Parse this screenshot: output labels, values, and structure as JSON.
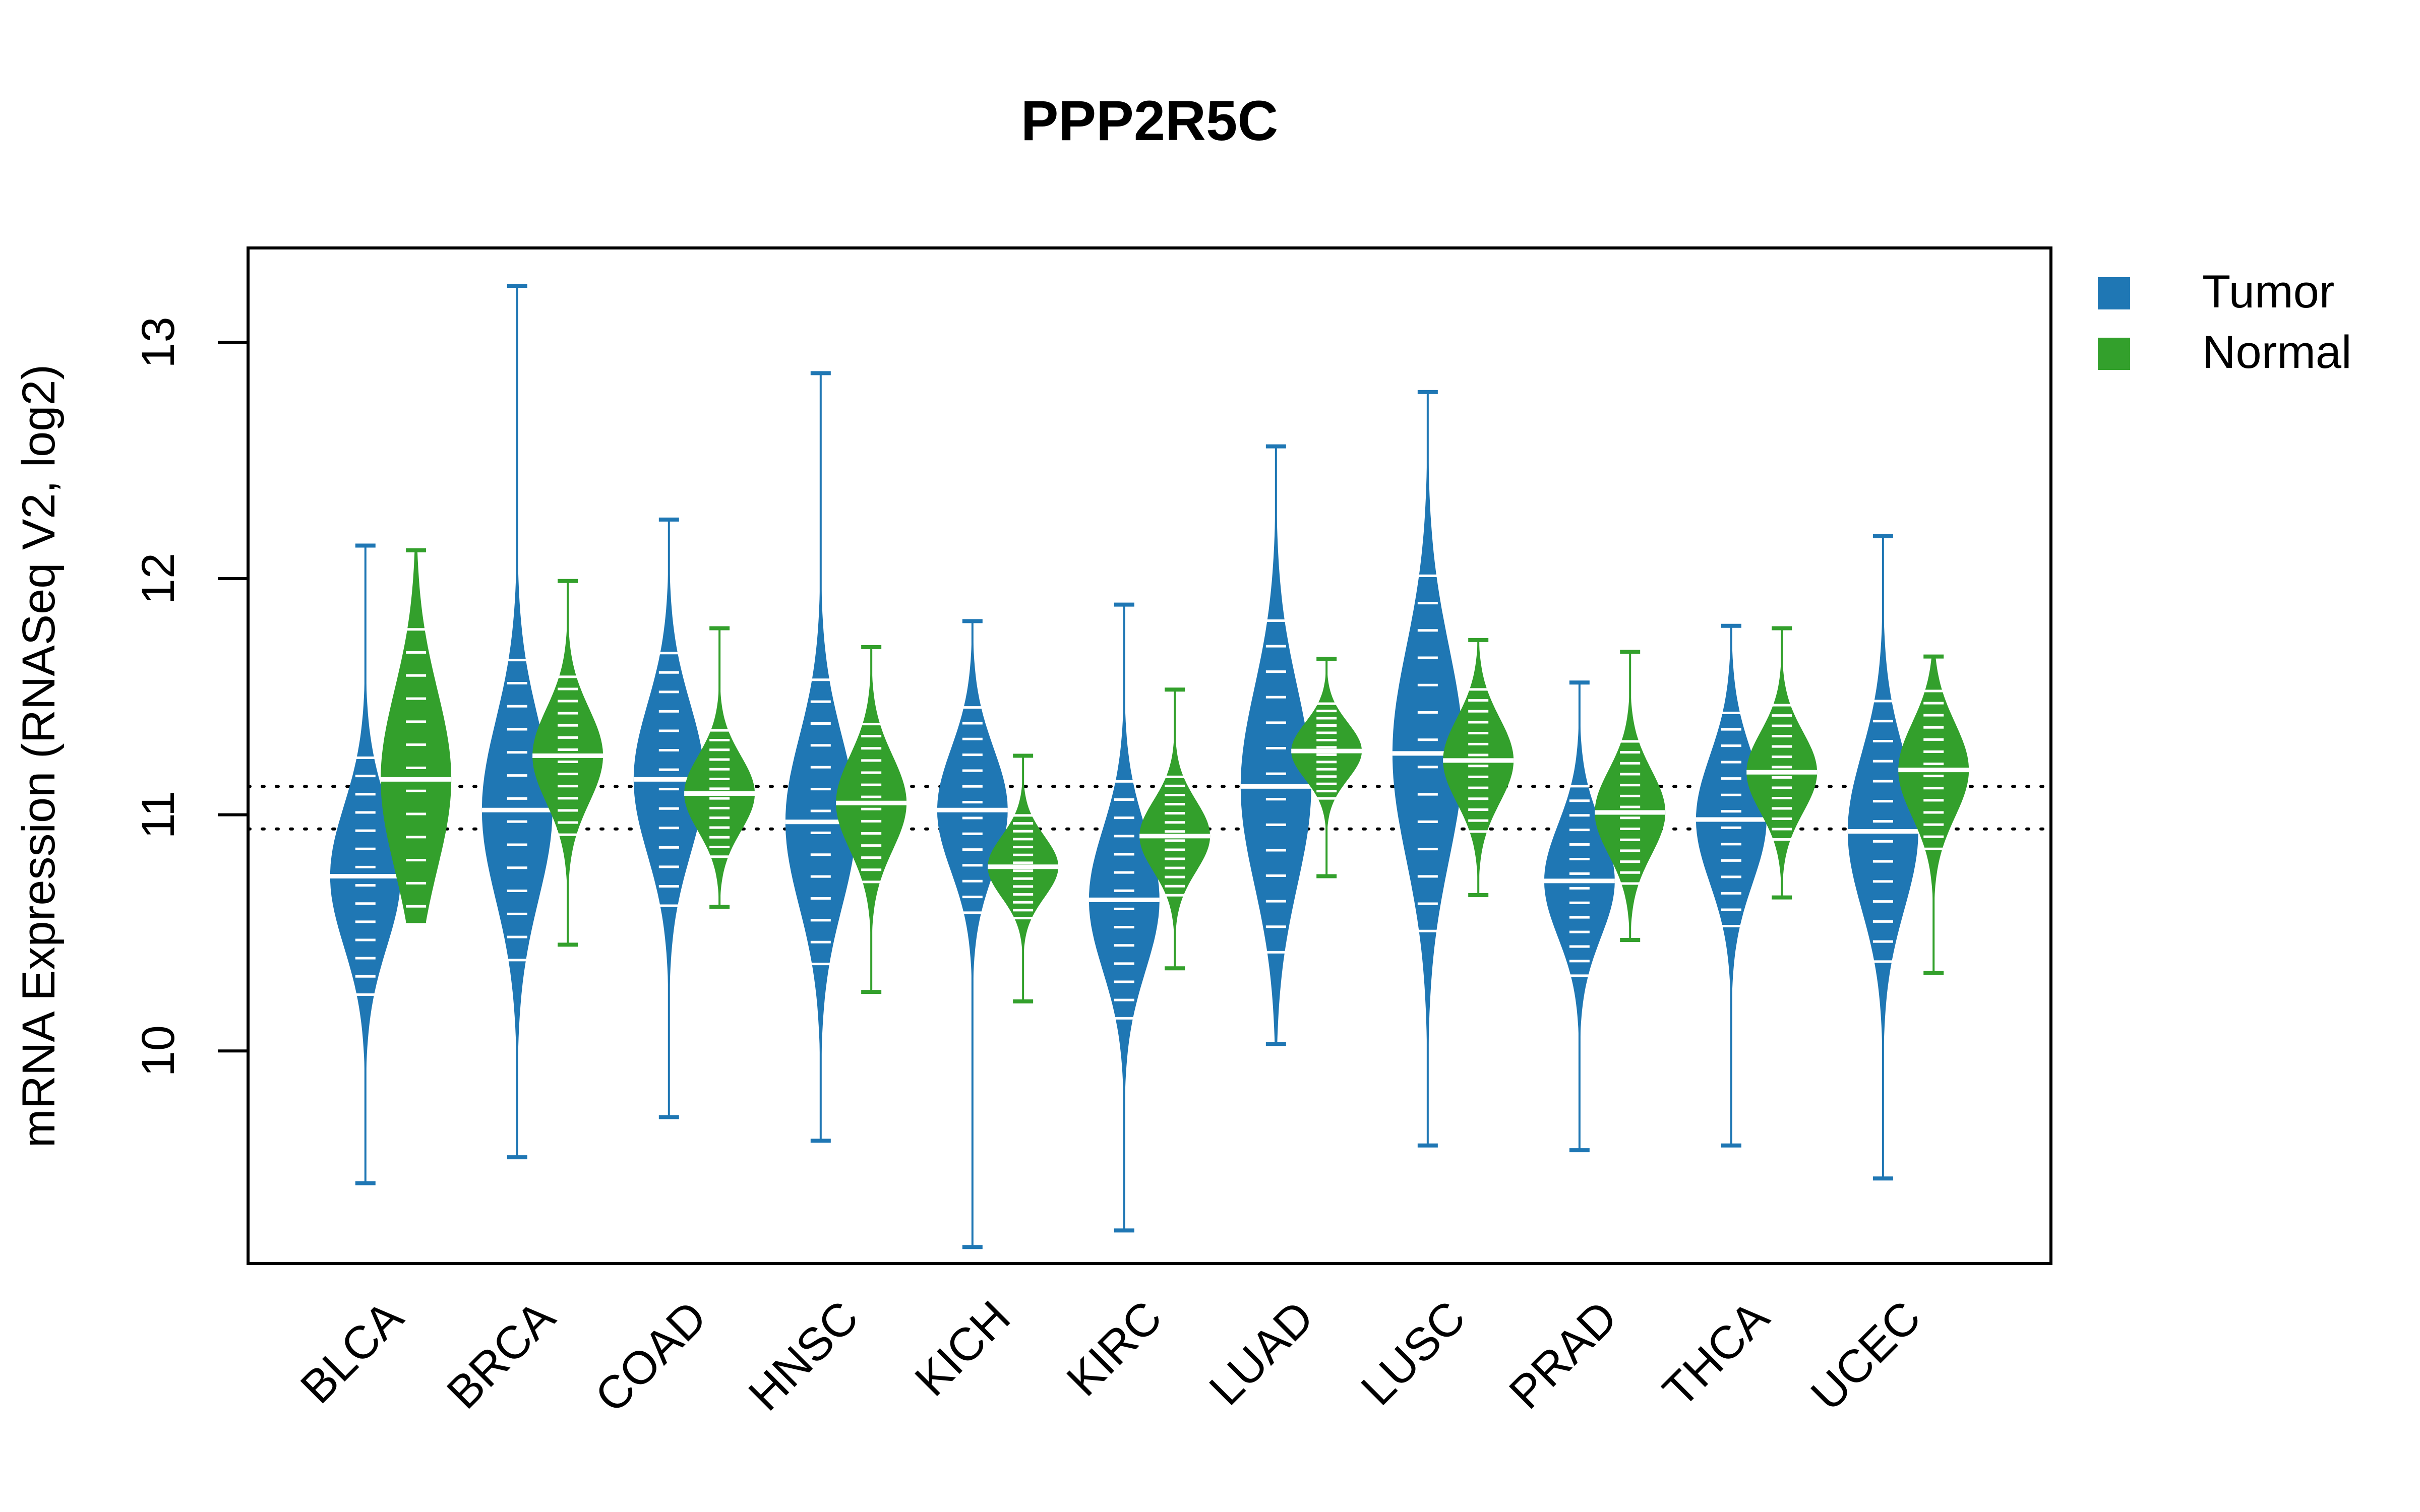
{
  "chart_data": {
    "type": "violin",
    "subtype": "beanplot",
    "title": "PPP2R5C",
    "xlabel": "",
    "ylabel": "mRNA Expression (RNASeq V2, log2)",
    "ylim": [
      9.1,
      13.4
    ],
    "yticks": [
      10,
      11,
      12,
      13
    ],
    "grid": false,
    "legend_position": "top-right-outside",
    "reference_lines": [
      11.12,
      10.94
    ],
    "categories": [
      "BLCA",
      "BRCA",
      "COAD",
      "HNSC",
      "KICH",
      "KIRC",
      "LUAD",
      "LUSC",
      "PRAD",
      "THCA",
      "UCEC"
    ],
    "series": [
      {
        "name": "Tumor",
        "color": "#1F77B4",
        "median": [
          10.74,
          11.02,
          11.15,
          10.97,
          11.02,
          10.64,
          11.12,
          11.26,
          10.72,
          10.98,
          10.93
        ],
        "min": [
          9.44,
          9.55,
          9.72,
          9.62,
          9.17,
          9.24,
          10.03,
          9.6,
          9.58,
          9.6,
          9.46
        ],
        "max": [
          12.14,
          13.24,
          12.25,
          12.87,
          11.82,
          11.89,
          12.56,
          12.79,
          11.56,
          11.8,
          12.18
        ],
        "spread": [
          0.3,
          0.38,
          0.32,
          0.36,
          0.26,
          0.3,
          0.42,
          0.45,
          0.24,
          0.27,
          0.33
        ]
      },
      {
        "name": "Normal",
        "color": "#33A02C",
        "median": [
          11.15,
          11.25,
          11.09,
          11.05,
          10.78,
          10.91,
          11.27,
          11.23,
          11.01,
          11.18,
          11.19
        ],
        "min": [
          10.55,
          10.45,
          10.61,
          10.25,
          10.21,
          10.35,
          10.74,
          10.66,
          10.47,
          10.65,
          10.33
        ],
        "max": [
          12.12,
          11.99,
          11.79,
          11.71,
          11.25,
          11.53,
          11.66,
          11.74,
          11.69,
          11.79,
          11.67
        ],
        "spread": [
          0.38,
          0.2,
          0.16,
          0.2,
          0.13,
          0.15,
          0.12,
          0.18,
          0.18,
          0.17,
          0.2
        ]
      }
    ]
  }
}
